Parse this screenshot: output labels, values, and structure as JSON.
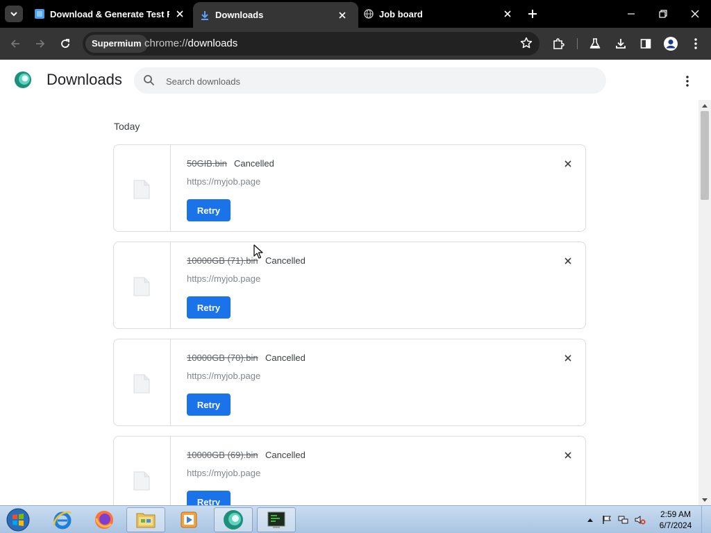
{
  "tabs": [
    {
      "title": "Download & Generate Test Files",
      "favicon": "page-icon"
    },
    {
      "title": "Downloads",
      "favicon": "download-icon",
      "active": true
    },
    {
      "title": "Job board",
      "favicon": "globe-icon"
    }
  ],
  "toolbar": {
    "chip_label": "Supermium",
    "url_scheme": "chrome://",
    "url_host": "downloads"
  },
  "page": {
    "title": "Downloads",
    "search_placeholder": "Search downloads",
    "section_label": "Today"
  },
  "downloads": [
    {
      "filename": "50GIB.bin",
      "status": "Cancelled",
      "source": "https://myjob.page",
      "action": "Retry"
    },
    {
      "filename": "10000GB (71).bin",
      "status": "Cancelled",
      "source": "https://myjob.page",
      "action": "Retry"
    },
    {
      "filename": "10000GB (70).bin",
      "status": "Cancelled",
      "source": "https://myjob.page",
      "action": "Retry"
    },
    {
      "filename": "10000GB (69).bin",
      "status": "Cancelled",
      "source": "https://myjob.page",
      "action": "Retry"
    }
  ],
  "taskbar": {
    "apps": [
      "internet-explorer-icon",
      "firefox-icon",
      "file-explorer-icon",
      "media-player-icon",
      "supermium-icon",
      "terminal-icon"
    ],
    "time": "2:59 AM",
    "date": "6/7/2024"
  },
  "colors": {
    "accent": "#1a73e8",
    "tabstrip": "#000000",
    "toolbar": "#353535"
  }
}
